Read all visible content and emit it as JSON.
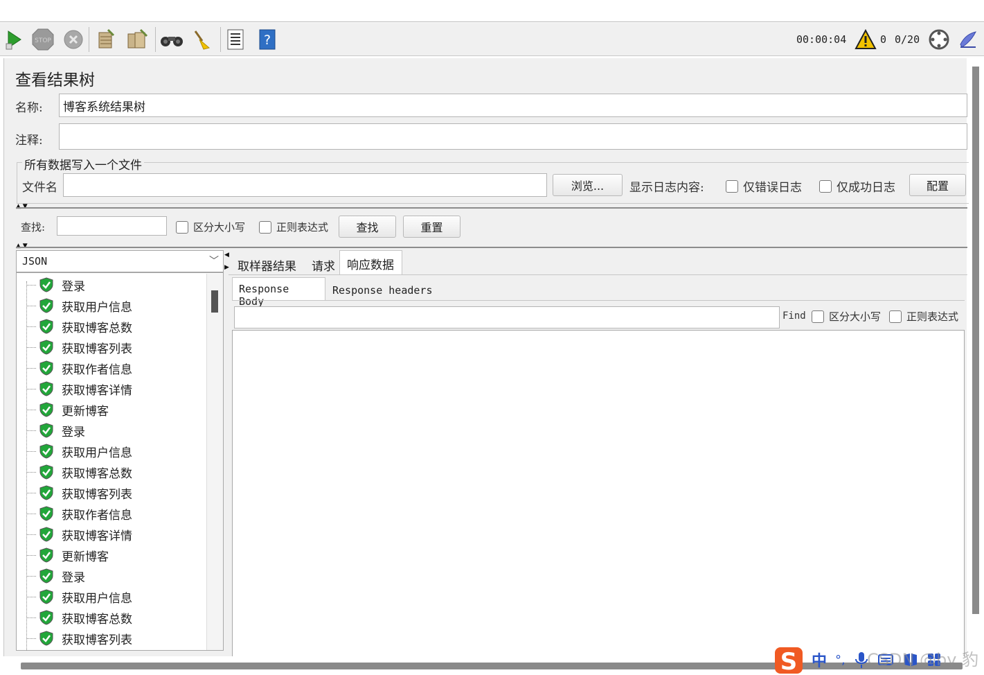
{
  "toolbar": {
    "buttons": [
      "start-icon",
      "stop-icon",
      "shutdown-icon",
      "clear-icon",
      "clear-all-icon",
      "search-icon",
      "reset-search-icon",
      "function-helper-icon",
      "help-icon"
    ],
    "timer": "00:00:04",
    "warnings": "0",
    "threads": "0/20",
    "colors": {
      "start": "#2e9e2e",
      "stop": "#8a8a8a",
      "warning": "#f2c200"
    }
  },
  "panel": {
    "title": "查看结果树",
    "name_label": "名称:",
    "name_value": "博客系统结果树",
    "comment_label": "注释:",
    "comment_value": "",
    "fieldset_legend": "所有数据写入一个文件",
    "file_label": "文件名",
    "file_value": "",
    "browse_button": "浏览...",
    "log_label": "显示日志内容:",
    "errors_only": "仅错误日志",
    "success_only": "仅成功日志",
    "configure_button": "配置"
  },
  "search": {
    "label": "查找:",
    "value": "",
    "case_sensitive": "区分大小写",
    "regex": "正则表达式",
    "find_button": "查找",
    "reset_button": "重置"
  },
  "renderer": {
    "selected": "JSON"
  },
  "tree": {
    "items": [
      "登录",
      "获取用户信息",
      "获取博客总数",
      "获取博客列表",
      "获取作者信息",
      "获取博客详情",
      "更新博客",
      "登录",
      "获取用户信息",
      "获取博客总数",
      "获取博客列表",
      "获取作者信息",
      "获取博客详情",
      "更新博客",
      "登录",
      "获取用户信息",
      "获取博客总数",
      "获取博客列表"
    ],
    "status_color": "#22a63a"
  },
  "result_tabs": {
    "tabs": [
      "取样器结果",
      "请求",
      "响应数据"
    ],
    "active": "响应数据",
    "sub_tabs": [
      "Response Body",
      "Response headers"
    ],
    "active_sub": "Response Body"
  },
  "response_find": {
    "label": "Find",
    "value": "",
    "case_sensitive": "区分大小写",
    "regex": "正则表达式"
  },
  "ime": {
    "lang": "中",
    "punct": "°,"
  },
  "watermark": "CSDN @by 豹"
}
